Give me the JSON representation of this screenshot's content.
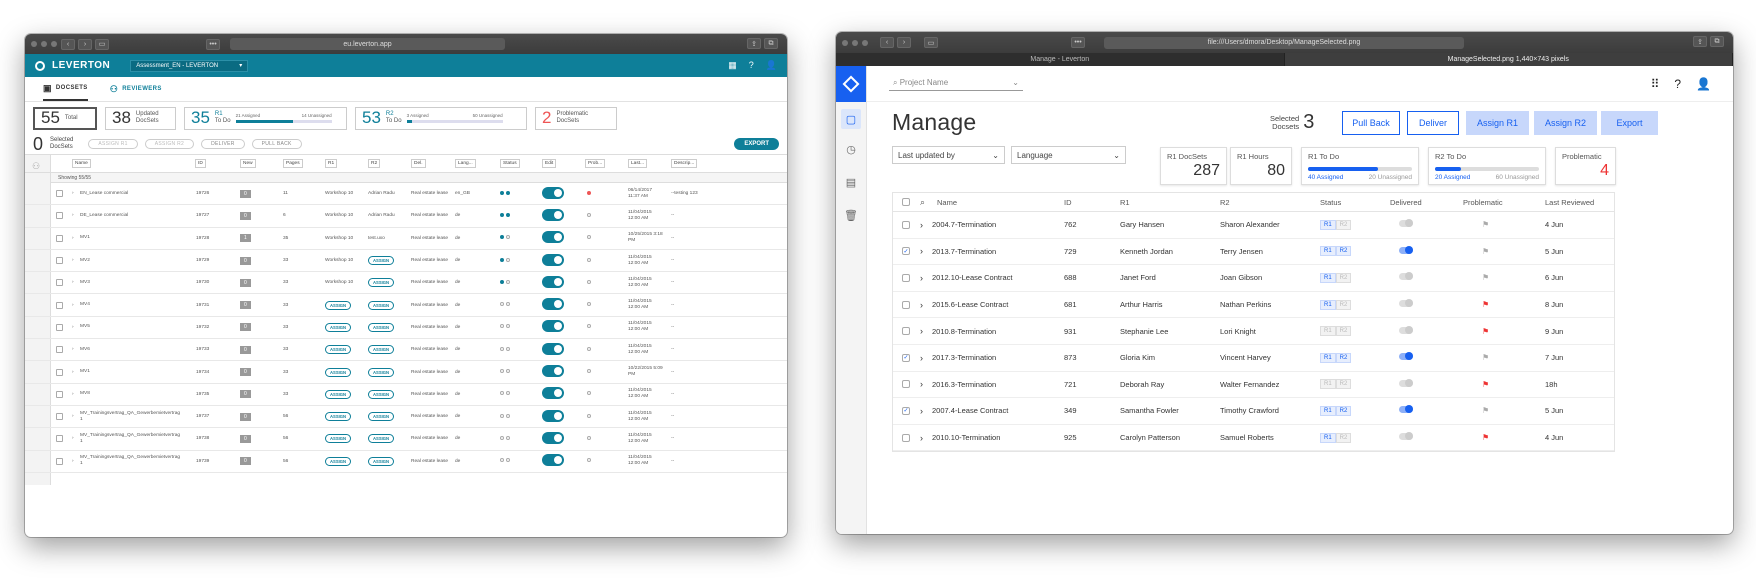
{
  "left_window": {
    "url": "eu.leverton.app",
    "brand": "LEVERTON",
    "project": "Assessment_EN - LEVERTON",
    "tabs": [
      "DOCSETS",
      "REVIEWERS"
    ],
    "stats": {
      "total": {
        "value": "55",
        "label": "Total"
      },
      "updated": {
        "value": "38",
        "label1": "Updated",
        "label2": "DocSets"
      },
      "r1": {
        "value": "35",
        "label1": "R1",
        "label2": "To Do",
        "assigned": "21 Assigned",
        "unassigned": "14 Unassigned",
        "progress": 0.6
      },
      "r2": {
        "value": "53",
        "label1": "R2",
        "label2": "To Do",
        "assigned": "3 Assigned",
        "unassigned": "50 Unassigned",
        "progress": 0.06
      },
      "problematic": {
        "value": "2",
        "label1": "Problematic",
        "label2": "DocSets"
      }
    },
    "selected": {
      "count": "0",
      "label1": "Selected",
      "label2": "DocSets"
    },
    "actions": [
      "ASSIGN R1",
      "ASSIGN R2",
      "DELIVER",
      "PULL BACK"
    ],
    "export": "EXPORT",
    "filters": [
      "Name",
      "ID",
      "New",
      "Pages",
      "R1",
      "R2",
      "Del.",
      "Lang...",
      "Status",
      "Edit",
      "Prob...",
      "Last...",
      "Descrip..."
    ],
    "showing": "Showing 55/55",
    "rows": [
      {
        "name": "EN_Lease commercial",
        "id": "19726",
        "pg": "0",
        "pages": "11",
        "r1": "Workshop 10",
        "r2": "Adrian Radu",
        "del": "Real estate lease",
        "lang": "en_GB",
        "dots": "ff",
        "prob": true,
        "last1": "06/14/2017",
        "last2": "11:37 AM",
        "desc": "--testing 123"
      },
      {
        "name": "DE_Lease commercial",
        "id": "19727",
        "pg": "0",
        "pages": "6",
        "r1": "Workshop 10",
        "r2": "Adrian Radu",
        "del": "Real estate lease",
        "lang": "de",
        "dots": "ff",
        "prob": false,
        "last1": "11/04/2015",
        "last2": "12:00 AM",
        "desc": "--"
      },
      {
        "name": "MV1",
        "id": "19728",
        "pg": "1",
        "pages": "35",
        "r1": "Workshop 10",
        "r2": "test.uxo",
        "del": "Real estate lease",
        "lang": "de",
        "dots": "fo",
        "prob": false,
        "last1": "10/25/2015 3:18",
        "last2": "PM",
        "desc": "--"
      },
      {
        "name": "MV2",
        "id": "19729",
        "pg": "0",
        "pages": "33",
        "r1": "Workshop 10",
        "r2": "ASSIGN",
        "del": "Real estate lease",
        "lang": "de",
        "dots": "fo",
        "prob": false,
        "last1": "11/04/2015",
        "last2": "12:00 AM",
        "desc": "--"
      },
      {
        "name": "MV3",
        "id": "19730",
        "pg": "0",
        "pages": "33",
        "r1": "Workshop 10",
        "r2": "ASSIGN",
        "del": "Real estate lease",
        "lang": "de",
        "dots": "fo",
        "prob": false,
        "last1": "11/04/2015",
        "last2": "12:00 AM",
        "desc": "--"
      },
      {
        "name": "MV4",
        "id": "19731",
        "pg": "0",
        "pages": "33",
        "r1": "ASSIGN",
        "r2": "ASSIGN",
        "del": "Real estate lease",
        "lang": "de",
        "dots": "oo",
        "prob": false,
        "last1": "11/04/2015",
        "last2": "12:00 AM",
        "desc": "--"
      },
      {
        "name": "MV5",
        "id": "19732",
        "pg": "0",
        "pages": "33",
        "r1": "ASSIGN",
        "r2": "ASSIGN",
        "del": "Real estate lease",
        "lang": "de",
        "dots": "oo",
        "prob": false,
        "last1": "11/04/2015",
        "last2": "12:00 AM",
        "desc": "--"
      },
      {
        "name": "MV6",
        "id": "19733",
        "pg": "0",
        "pages": "33",
        "r1": "ASSIGN",
        "r2": "ASSIGN",
        "del": "Real estate lease",
        "lang": "de",
        "dots": "oo",
        "prob": false,
        "last1": "11/04/2015",
        "last2": "12:00 AM",
        "desc": "--"
      },
      {
        "name": "MV1",
        "id": "19734",
        "pg": "0",
        "pages": "33",
        "r1": "ASSIGN",
        "r2": "ASSIGN",
        "del": "Real estate lease",
        "lang": "de",
        "dots": "oo",
        "prob": false,
        "last1": "10/22/2015 5:09",
        "last2": "PM",
        "desc": "--"
      },
      {
        "name": "MV8",
        "id": "19735",
        "pg": "0",
        "pages": "33",
        "r1": "ASSIGN",
        "r2": "ASSIGN",
        "del": "Real estate lease",
        "lang": "de",
        "dots": "oo",
        "prob": false,
        "last1": "11/04/2015",
        "last2": "12:00 AM",
        "desc": "--"
      },
      {
        "name": "MV_Trainingsvertrag_QA_Gewerbemietvertrag",
        "name2": "1",
        "id": "19737",
        "pg": "0",
        "pages": "56",
        "r1": "ASSIGN",
        "r2": "ASSIGN",
        "del": "Real estate lease",
        "lang": "de",
        "dots": "oo",
        "prob": false,
        "last1": "11/04/2015",
        "last2": "12:00 AM",
        "desc": "--"
      },
      {
        "name": "MV_Trainingsvertrag_QA_Gewerbemietvertrag",
        "name2": "1",
        "id": "19738",
        "pg": "0",
        "pages": "56",
        "r1": "ASSIGN",
        "r2": "ASSIGN",
        "del": "Real estate lease",
        "lang": "de",
        "dots": "oo",
        "prob": false,
        "last1": "11/04/2015",
        "last2": "12:00 AM",
        "desc": "--"
      },
      {
        "name": "MV_Trainingsvertrag_QA_Gewerbemietvertrag",
        "name2": "1",
        "id": "19739",
        "pg": "0",
        "pages": "56",
        "r1": "ASSIGN",
        "r2": "ASSIGN",
        "del": "Real estate lease",
        "lang": "de",
        "dots": "oo",
        "prob": false,
        "last1": "11/04/2015",
        "last2": "12:00 AM",
        "desc": "--"
      }
    ]
  },
  "right_window": {
    "url": "file:///Users/dmora/Desktop/ManageSelected.png",
    "tabs": [
      "Manage - Leverton",
      "ManageSelected.png 1,440×743 pixels"
    ],
    "project_placeholder": "Project Name",
    "title": "Manage",
    "selected": {
      "label1": "Selected",
      "label2": "Docsets",
      "count": "3"
    },
    "buttons": [
      "Pull Back",
      "Deliver",
      "Assign R1",
      "Assign R2",
      "Export"
    ],
    "sort": "Last updated by",
    "language": "Language",
    "cards": {
      "r1_docsets": {
        "label": "R1 DocSets",
        "value": "287"
      },
      "r1_hours": {
        "label": "R1 Hours",
        "value": "80"
      },
      "r1_todo": {
        "label": "R1 To Do",
        "assigned": "40 Assigned",
        "unassigned": "20 Unassigned",
        "progress": 0.67
      },
      "r2_todo": {
        "label": "R2 To Do",
        "assigned": "20 Assigned",
        "unassigned": "60 Unassigned",
        "progress": 0.25
      },
      "problematic": {
        "label": "Problematic",
        "value": "4"
      }
    },
    "headers": [
      "Name",
      "ID",
      "R1",
      "R2",
      "Status",
      "Delivered",
      "Problematic",
      "Last Reviewed"
    ],
    "rows": [
      {
        "name": "2004.7-Termination",
        "id": "762",
        "r1": "Gary Hansen",
        "r2": "Sharon Alexander",
        "checked": false,
        "s1": true,
        "s2": false,
        "delivered": false,
        "problem": false,
        "last": "4 Jun"
      },
      {
        "name": "2013.7-Termination",
        "id": "729",
        "r1": "Kenneth Jordan",
        "r2": "Terry Jensen",
        "checked": true,
        "s1": true,
        "s2": true,
        "delivered": true,
        "problem": false,
        "last": "5 Jun"
      },
      {
        "name": "2012.10-Lease Contract",
        "id": "688",
        "r1": "Janet Ford",
        "r2": "Joan Gibson",
        "checked": false,
        "s1": true,
        "s2": false,
        "delivered": false,
        "problem": false,
        "last": "6 Jun"
      },
      {
        "name": "2015.6-Lease Contract",
        "id": "681",
        "r1": "Arthur Harris",
        "r2": "Nathan Perkins",
        "checked": false,
        "s1": true,
        "s2": false,
        "delivered": false,
        "problem": true,
        "last": "8 Jun"
      },
      {
        "name": "2010.8-Termination",
        "id": "931",
        "r1": "Stephanie Lee",
        "r2": "Lori Knight",
        "checked": false,
        "s1": false,
        "s2": false,
        "delivered": false,
        "problem": true,
        "last": "9 Jun"
      },
      {
        "name": "2017.3-Termination",
        "id": "873",
        "r1": "Gloria Kim",
        "r2": "Vincent Harvey",
        "checked": true,
        "s1": true,
        "s2": true,
        "delivered": true,
        "problem": false,
        "last": "7 Jun"
      },
      {
        "name": "2016.3-Termination",
        "id": "721",
        "r1": "Deborah Ray",
        "r2": "Walter Fernandez",
        "checked": false,
        "s1": false,
        "s2": false,
        "delivered": false,
        "problem": true,
        "last": "18h"
      },
      {
        "name": "2007.4-Lease Contract",
        "id": "349",
        "r1": "Samantha Fowler",
        "r2": "Timothy Crawford",
        "checked": true,
        "s1": true,
        "s2": true,
        "delivered": true,
        "problem": false,
        "last": "5 Jun"
      },
      {
        "name": "2010.10-Termination",
        "id": "925",
        "r1": "Carolyn Patterson",
        "r2": "Samuel Roberts",
        "checked": false,
        "s1": true,
        "s2": false,
        "delivered": false,
        "problem": true,
        "last": "4 Jun"
      }
    ]
  }
}
